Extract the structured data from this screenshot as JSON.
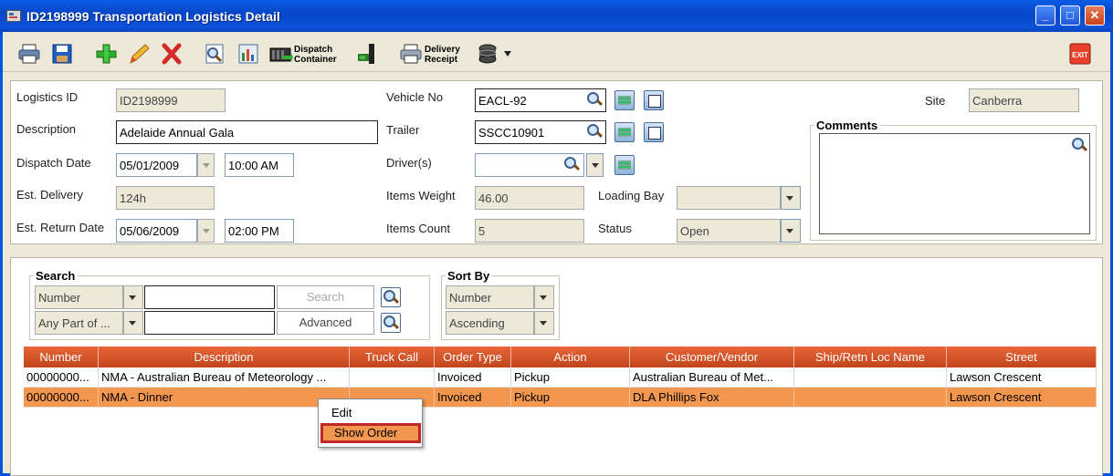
{
  "window": {
    "title": "ID2198999 Transportation Logistics Detail",
    "controls": {
      "minimize": "_",
      "maximize": "□",
      "close": "✕"
    }
  },
  "toolbar": {
    "dispatch_container_label": [
      "Dispatch",
      "Container"
    ],
    "delivery_receipt_label": [
      "Delivery",
      "Receipt"
    ],
    "exit_label": "EXIT",
    "icons": [
      "print-icon",
      "save-icon",
      "add-icon",
      "edit-pencil-icon",
      "delete-icon",
      "search-report-icon",
      "report-icon",
      "dispatch-container-icon",
      "load-truck-icon",
      "delivery-receipt-icon",
      "database-icon",
      "exit-icon"
    ]
  },
  "form": {
    "logistics_id_label": "Logistics ID",
    "logistics_id_value": "ID2198999",
    "description_label": "Description",
    "description_value": "Adelaide Annual Gala",
    "dispatch_date_label": "Dispatch Date",
    "dispatch_date_value": "05/01/2009",
    "dispatch_time_value": "10:00 AM",
    "est_delivery_label": "Est. Delivery",
    "est_delivery_value": "124h",
    "est_return_label": "Est. Return Date",
    "est_return_date_value": "05/06/2009",
    "est_return_time_value": "02:00 PM",
    "vehicle_label": "Vehicle No",
    "vehicle_value": "EACL-92",
    "trailer_label": "Trailer",
    "trailer_value": "SSCC10901",
    "drivers_label": "Driver(s)",
    "drivers_value": "",
    "items_weight_label": "Items Weight",
    "items_weight_value": "46.00",
    "items_count_label": "Items Count",
    "items_count_value": "5",
    "loading_bay_label": "Loading Bay",
    "loading_bay_value": "",
    "status_label": "Status",
    "status_value": "Open",
    "site_label": "Site",
    "site_value": "Canberra",
    "comments_label": "Comments"
  },
  "search": {
    "legend": "Search",
    "field1": "Number",
    "input1": "",
    "search_button": "Search",
    "field2": "Any Part of ...",
    "input2": "",
    "advanced_button": "Advanced"
  },
  "sort": {
    "legend": "Sort By",
    "field": "Number",
    "order": "Ascending"
  },
  "grid": {
    "headers": [
      "Number",
      "Description",
      "Truck Call",
      "Order Type",
      "Action",
      "Customer/Vendor",
      "Ship/Retn Loc Name",
      "Street"
    ],
    "rows": [
      [
        "00000000...",
        "NMA - Australian Bureau of Meteorology ...",
        "",
        "Invoiced",
        "Pickup",
        "Australian Bureau of Met...",
        "",
        "Lawson Crescent"
      ],
      [
        "00000000...",
        "NMA - Dinner",
        "",
        "Invoiced",
        "Pickup",
        "DLA Phillips Fox",
        "",
        "Lawson Crescent"
      ]
    ],
    "selected_row": 1
  },
  "context_menu": {
    "items": [
      "Edit",
      "Show Order"
    ],
    "highlighted": 1
  },
  "colors": {
    "header_orange": "#D9542A",
    "selected_row": "#F3964F",
    "highlight_border": "#C0282A",
    "titlebar_blue": "#0A52D9"
  }
}
